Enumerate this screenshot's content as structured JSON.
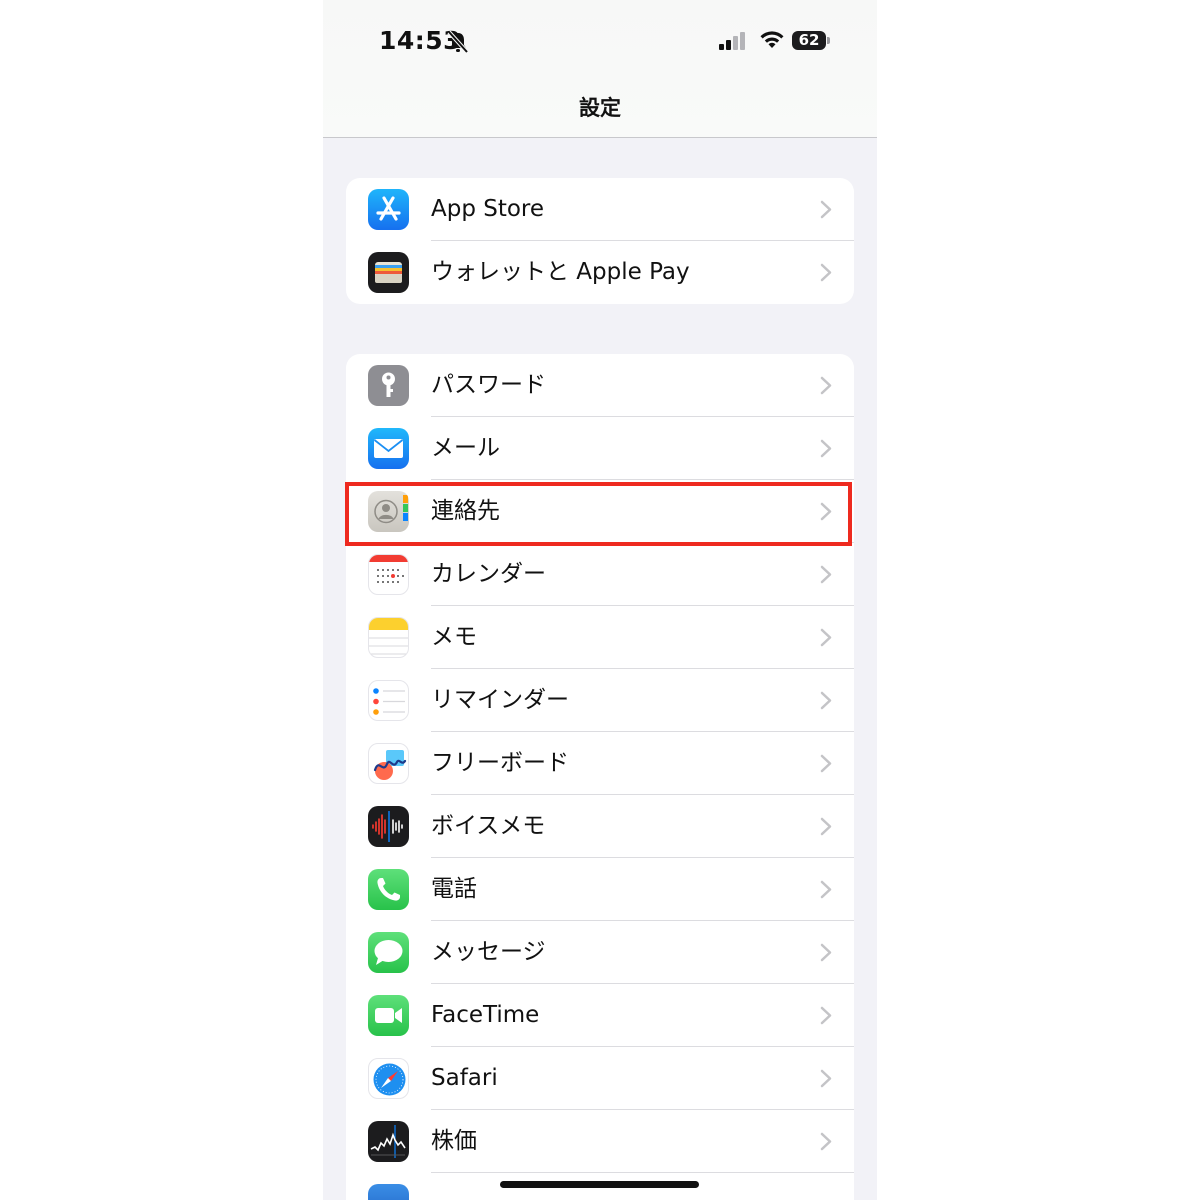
{
  "status": {
    "time": "14:53",
    "battery": "62"
  },
  "nav": {
    "title": "設定"
  },
  "group1": [
    {
      "label": "App Store",
      "icon": "app-store-icon"
    },
    {
      "label": "ウォレットと Apple Pay",
      "icon": "wallet-icon"
    }
  ],
  "group2": [
    {
      "label": "パスワード",
      "icon": "passwords-icon"
    },
    {
      "label": "メール",
      "icon": "mail-icon"
    },
    {
      "label": "連絡先",
      "icon": "contacts-icon"
    },
    {
      "label": "カレンダー",
      "icon": "calendar-icon"
    },
    {
      "label": "メモ",
      "icon": "notes-icon"
    },
    {
      "label": "リマインダー",
      "icon": "reminders-icon"
    },
    {
      "label": "フリーボード",
      "icon": "freeform-icon"
    },
    {
      "label": "ボイスメモ",
      "icon": "voice-memos-icon"
    },
    {
      "label": "電話",
      "icon": "phone-icon"
    },
    {
      "label": "メッセージ",
      "icon": "messages-icon"
    },
    {
      "label": "FaceTime",
      "icon": "facetime-icon"
    },
    {
      "label": "Safari",
      "icon": "safari-icon"
    },
    {
      "label": "株価",
      "icon": "stocks-icon"
    }
  ],
  "colors": {
    "highlight": "#ee2a1f",
    "background": "#f2f2f7",
    "app_store": "#1a8cf5",
    "mail": "#1f8ef5",
    "phone": "#34c759",
    "messages": "#34c759",
    "facetime": "#34c759"
  }
}
